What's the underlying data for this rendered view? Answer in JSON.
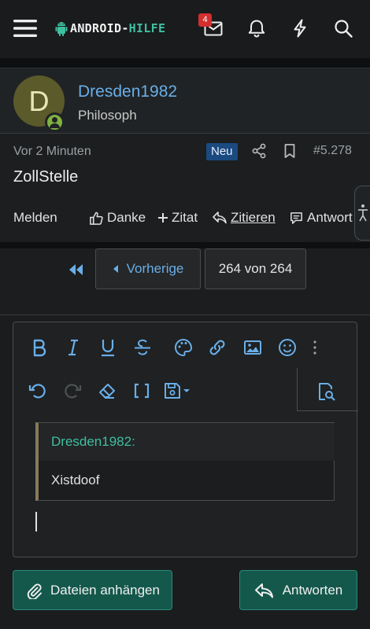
{
  "header": {
    "logo_part1": "ANDROID-",
    "logo_part2": "HILFE",
    "inbox_count": "4"
  },
  "post": {
    "user": {
      "avatar_letter": "D",
      "name": "Dresden1982",
      "title": "Philosoph"
    },
    "time": "Vor 2 Minuten",
    "new_badge": "Neu",
    "number": "#5.278",
    "body": "ZollStelle",
    "actions": {
      "report": "Melden",
      "like": "Danke",
      "multiquote": "Zitat",
      "quote": "Zitieren",
      "reply": "Antwort"
    }
  },
  "pagination": {
    "prev_label": "Vorherige",
    "page_count": "264 von 264"
  },
  "editor": {
    "quote_author": "Dresden1982:",
    "quote_text": "Xistdoof"
  },
  "buttons": {
    "attach": "Dateien anhängen",
    "submit": "Antworten"
  },
  "colors": {
    "link": "#6aaee8",
    "accent": "#3fbfa0",
    "button": "#14584c",
    "badge": "#d32f2f"
  }
}
